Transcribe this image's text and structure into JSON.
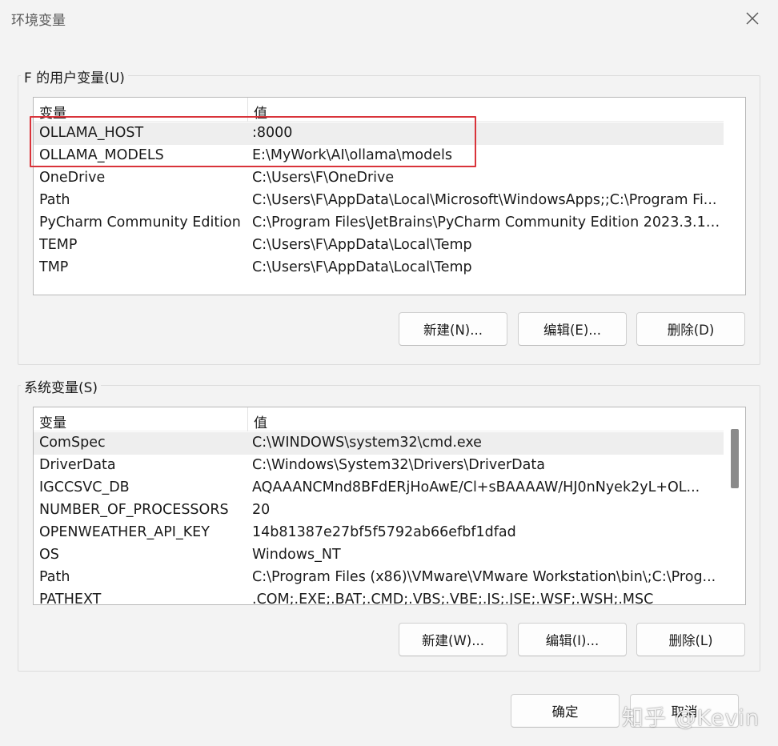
{
  "window": {
    "title": "环境变量"
  },
  "user_group": {
    "label": "F 的用户变量(U)",
    "columns": [
      "变量",
      "值"
    ],
    "rows": [
      {
        "name": "OLLAMA_HOST",
        "value": ":8000"
      },
      {
        "name": "OLLAMA_MODELS",
        "value": "E:\\MyWork\\AI\\ollama\\models"
      },
      {
        "name": "OneDrive",
        "value": "C:\\Users\\F\\OneDrive"
      },
      {
        "name": "Path",
        "value": "C:\\Users\\F\\AppData\\Local\\Microsoft\\WindowsApps;;C:\\Program Fi..."
      },
      {
        "name": "PyCharm Community Edition",
        "value": "C:\\Program Files\\JetBrains\\PyCharm Community Edition 2023.3.1\\..."
      },
      {
        "name": "TEMP",
        "value": "C:\\Users\\F\\AppData\\Local\\Temp"
      },
      {
        "name": "TMP",
        "value": "C:\\Users\\F\\AppData\\Local\\Temp"
      }
    ],
    "buttons": {
      "new": "新建(N)...",
      "edit": "编辑(E)...",
      "delete": "删除(D)"
    }
  },
  "system_group": {
    "label": "系统变量(S)",
    "columns": [
      "变量",
      "值"
    ],
    "rows": [
      {
        "name": "ComSpec",
        "value": "C:\\WINDOWS\\system32\\cmd.exe"
      },
      {
        "name": "DriverData",
        "value": "C:\\Windows\\System32\\Drivers\\DriverData"
      },
      {
        "name": "IGCCSVC_DB",
        "value": "AQAAANCMnd8BFdERjHoAwE/Cl+sBAAAAW/HJ0nNyek2yL+OL..."
      },
      {
        "name": "NUMBER_OF_PROCESSORS",
        "value": "20"
      },
      {
        "name": "OPENWEATHER_API_KEY",
        "value": "14b81387e27bf5f5792ab66efbf1dfad"
      },
      {
        "name": "OS",
        "value": "Windows_NT"
      },
      {
        "name": "Path",
        "value": "C:\\Program Files (x86)\\VMware\\VMware Workstation\\bin\\;C:\\Prog..."
      },
      {
        "name": "PATHEXT",
        "value": ".COM;.EXE;.BAT;.CMD;.VBS;.VBE;.JS;.JSE;.WSF;.WSH;.MSC"
      }
    ],
    "buttons": {
      "new": "新建(W)...",
      "edit": "编辑(I)...",
      "delete": "删除(L)"
    }
  },
  "footer": {
    "ok": "确定",
    "cancel": "取消"
  },
  "watermark": "知乎 @Kevin",
  "colors": {
    "highlight": "#d9333a",
    "selection": "#eeeeee"
  },
  "icons": {
    "close": "close-icon"
  }
}
